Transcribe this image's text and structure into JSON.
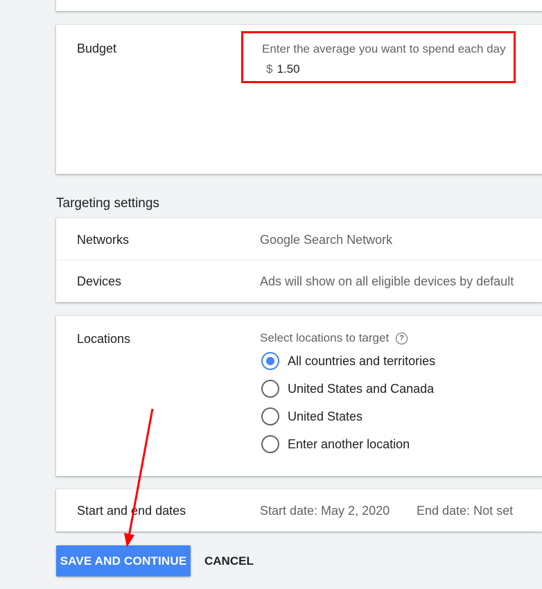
{
  "budget": {
    "label": "Budget",
    "hint": "Enter the average you want to spend each day",
    "currency": "$",
    "value": "1.50"
  },
  "targeting": {
    "title": "Targeting settings",
    "networks": {
      "label": "Networks",
      "value": "Google Search Network"
    },
    "devices": {
      "label": "Devices",
      "value": "Ads will show on all eligible devices by default"
    }
  },
  "locations": {
    "label": "Locations",
    "prompt": "Select locations to target",
    "help_icon": "?",
    "options": [
      {
        "label": "All countries and territories",
        "selected": true
      },
      {
        "label": "United States and Canada",
        "selected": false
      },
      {
        "label": "United States",
        "selected": false
      },
      {
        "label": "Enter another location",
        "selected": false
      }
    ]
  },
  "dates": {
    "label": "Start and end dates",
    "start": "Start date: May 2, 2020",
    "end": "End date: Not set"
  },
  "actions": {
    "save_label": "SAVE AND CONTINUE",
    "cancel_label": "CANCEL"
  },
  "colors": {
    "accent": "#4285f4",
    "annotation": "#ff0000"
  }
}
